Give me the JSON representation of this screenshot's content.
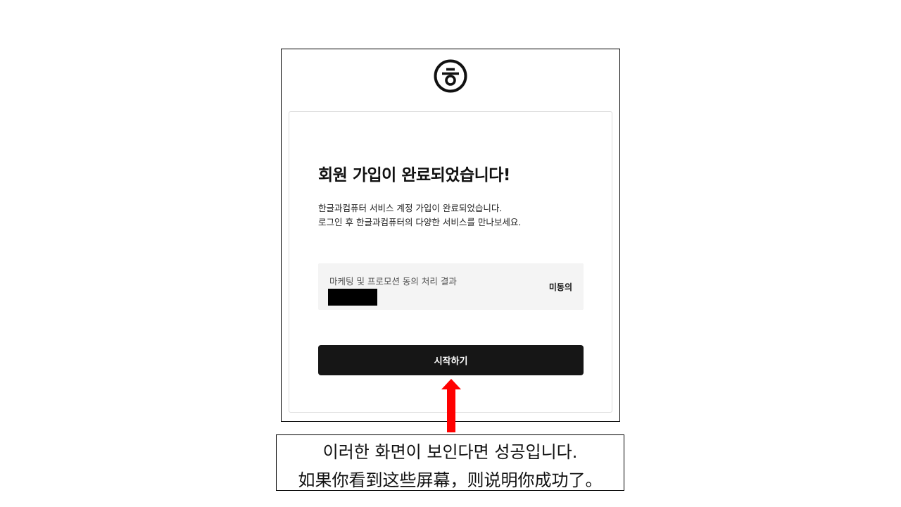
{
  "logo": {
    "icon": "hancom-logo-icon",
    "glyph": "ㅎ"
  },
  "card": {
    "title": "회원 가입이 완료되었습니다!",
    "description_lines": [
      "한글과컴퓨터 서비스 계정 가입이 완료되었습니다.",
      "로그인 후 한글과컴퓨터의 다양한 서비스를 만나보세요."
    ],
    "consent": {
      "label": "마케팅 및 프로모션 동의 처리 결과",
      "status": "미동의"
    },
    "start_button_label": "시작하기"
  },
  "annotation": {
    "arrow_color": "#ff0000",
    "caption_korean": "이러한 화면이 보인다면 성공입니다.",
    "caption_chinese": "如果你看到这些屏幕，则说明你成功了。"
  }
}
